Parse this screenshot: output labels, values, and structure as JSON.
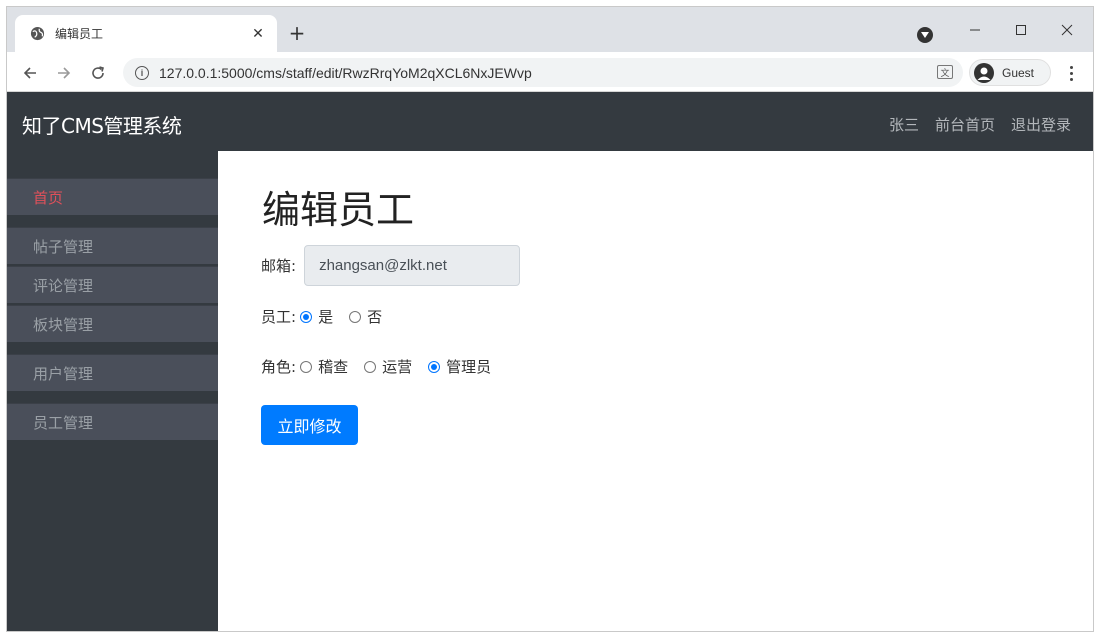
{
  "browser": {
    "tab_title": "编辑员工",
    "tab_close": "✕",
    "new_tab": "+",
    "url": "127.0.0.1:5000/cms/staff/edit/RwzRrqYoM2qXCL6NxJEWvp",
    "profile_label": "Guest",
    "icons": [
      "globe-icon",
      "close-icon",
      "plus-icon",
      "back-icon",
      "forward-icon",
      "reload-icon",
      "info-icon",
      "translate-icon",
      "avatar-icon",
      "more-icon",
      "minimize-icon",
      "maximize-icon",
      "window-close-icon"
    ]
  },
  "header": {
    "brand": "知了CMS管理系统",
    "links": [
      "张三",
      "前台首页",
      "退出登录"
    ]
  },
  "sidebar": {
    "items": [
      {
        "label": "首页",
        "active": true
      },
      {
        "label": "帖子管理",
        "active": false
      },
      {
        "label": "评论管理",
        "active": false
      },
      {
        "label": "板块管理",
        "active": false
      },
      {
        "label": "用户管理",
        "active": false
      },
      {
        "label": "员工管理",
        "active": false
      }
    ]
  },
  "form": {
    "title": "编辑员工",
    "email_label": "邮箱:",
    "email_value": "zhangsan@zlkt.net",
    "staff_label": "员工:",
    "staff_options": [
      {
        "label": "是",
        "checked": true
      },
      {
        "label": "否",
        "checked": false
      }
    ],
    "role_label": "角色:",
    "role_options": [
      {
        "label": "稽查",
        "checked": false
      },
      {
        "label": "运营",
        "checked": false
      },
      {
        "label": "管理员",
        "checked": true
      }
    ],
    "submit_label": "立即修改"
  },
  "colors": {
    "navbar": "#343a40",
    "sidebar_item": "#4a4f5a",
    "active_item": "#e0505a",
    "primary": "#007bff",
    "radio": "#0075ff"
  }
}
